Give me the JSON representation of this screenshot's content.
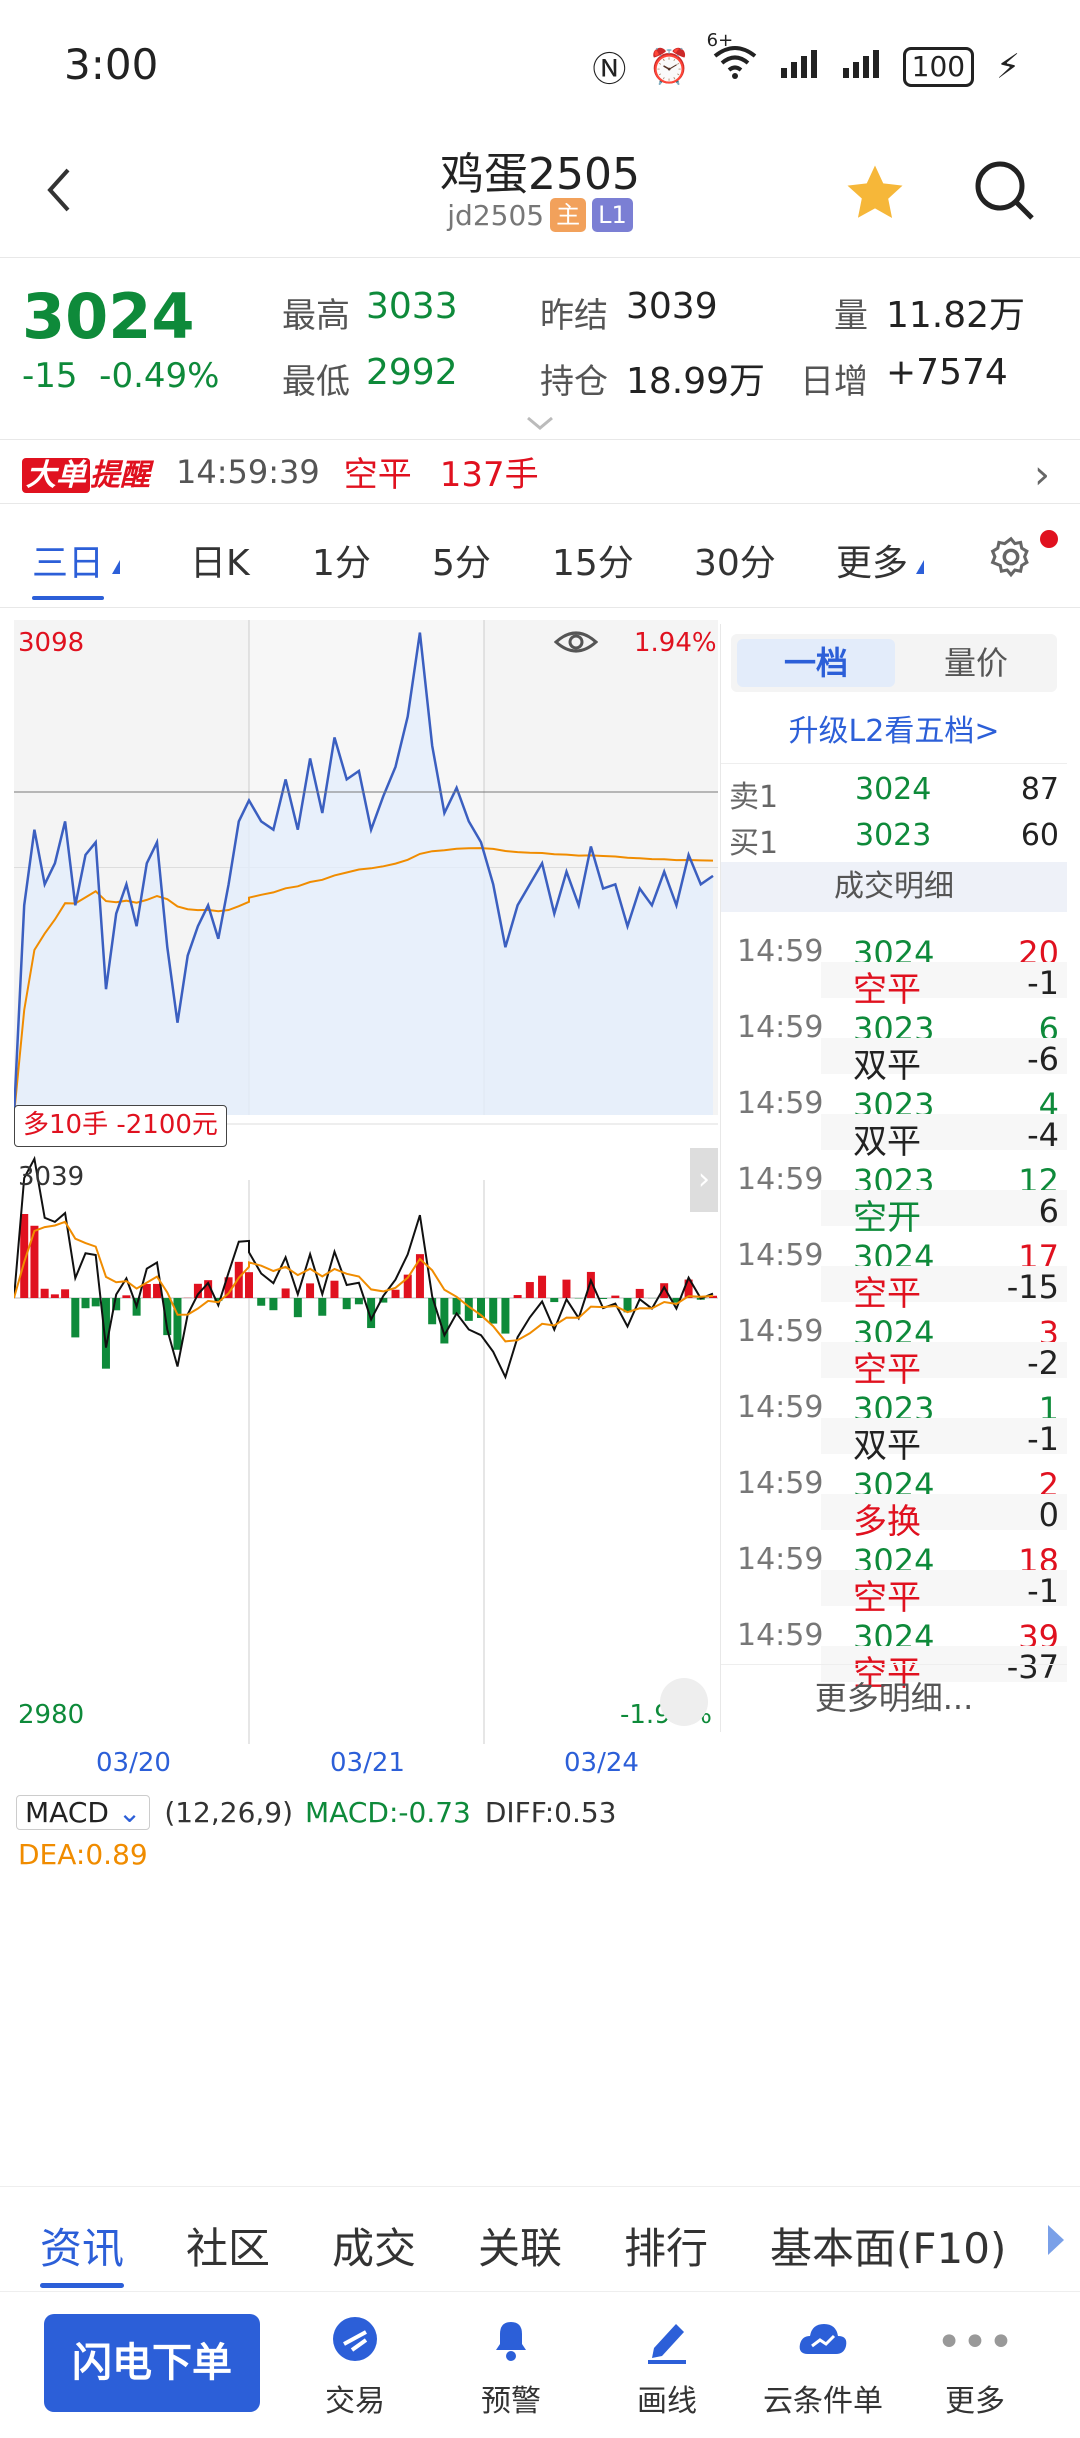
{
  "status_bar": {
    "time": "3:00",
    "signal_label": "6+",
    "battery": "100"
  },
  "header": {
    "title": "鸡蛋2505",
    "code": "jd2505",
    "tag_main": "主",
    "tag_level": "L1"
  },
  "quote": {
    "price": "3024",
    "change": "-15",
    "change_pct": "-0.49%",
    "high_label": "最高",
    "high": "3033",
    "low_label": "最低",
    "low": "2992",
    "prev_settle_label": "昨结",
    "prev_settle": "3039",
    "open_int_label": "持仓",
    "open_int": "18.99万",
    "volume_label": "量",
    "volume": "11.82万",
    "daily_inc_label": "日增",
    "daily_inc": "+7574"
  },
  "alert": {
    "badge_a": "大单",
    "badge_b": "提醒",
    "time": "14:59:39",
    "action": "空平",
    "volume": "137手"
  },
  "period_tabs": [
    "三日",
    "日K",
    "1分",
    "5分",
    "15分",
    "30分",
    "更多"
  ],
  "chart": {
    "y_top": "3098",
    "y_mid": "3039",
    "y_bot": "2980",
    "pct_top": "1.94%",
    "pct_bot": "-1.94%",
    "position_note": "多10手  -2100元",
    "dates": [
      "03/20",
      "03/21",
      "03/24"
    ],
    "macd": {
      "name": "MACD",
      "params": "(12,26,9)",
      "macd": "MACD:-0.73",
      "diff": "DIFF:0.53",
      "dea": "DEA:0.89"
    }
  },
  "chart_data": {
    "type": "line",
    "price_range": [
      2980,
      3098
    ],
    "reference": 3039,
    "days": [
      "03/20",
      "03/21",
      "03/24"
    ],
    "series": [
      {
        "values": [
          2980,
          3030,
          3048,
          3035,
          3040,
          3050,
          3030,
          3042,
          3045,
          3010,
          3028,
          3035,
          3025,
          3040,
          3045,
          3020,
          3002,
          3018,
          3025,
          3030,
          3022,
          3035,
          3050,
          3055
        ]
      },
      {
        "values": [
          3055,
          3050,
          3048,
          3060,
          3048,
          3065,
          3052,
          3070,
          3060,
          3062,
          3048,
          3056,
          3063,
          3075,
          3095,
          3068,
          3052,
          3058,
          3050,
          3045,
          3035,
          3020,
          3030,
          3035,
          3040,
          3028,
          3038,
          3030,
          3044,
          3034,
          3035,
          3025,
          3034,
          3030,
          3038,
          3030,
          3042,
          3035,
          3037
        ]
      }
    ]
  },
  "side": {
    "tab_on": "一档",
    "tab_off": "量价",
    "upgrade": "升级L2看五档>",
    "ask": {
      "label": "卖1",
      "price": "3024",
      "vol": "87"
    },
    "bid": {
      "label": "买1",
      "price": "3023",
      "vol": "60"
    },
    "section": "成交明细",
    "trades": [
      {
        "time": "14:59",
        "price": "3024",
        "vol": "20",
        "vol_color": "red",
        "action": "空平",
        "action_color": "red",
        "delta": "-1"
      },
      {
        "time": "14:59",
        "price": "3023",
        "vol": "6",
        "vol_color": "green",
        "action": "双平",
        "action_color": "black",
        "delta": "-6"
      },
      {
        "time": "14:59",
        "price": "3023",
        "vol": "4",
        "vol_color": "green",
        "action": "双平",
        "action_color": "black",
        "delta": "-4"
      },
      {
        "time": "14:59",
        "price": "3023",
        "vol": "12",
        "vol_color": "green",
        "action": "空开",
        "action_color": "green",
        "delta": "6"
      },
      {
        "time": "14:59",
        "price": "3024",
        "vol": "17",
        "vol_color": "red",
        "action": "空平",
        "action_color": "red",
        "delta": "-15"
      },
      {
        "time": "14:59",
        "price": "3024",
        "vol": "3",
        "vol_color": "red",
        "action": "空平",
        "action_color": "red",
        "delta": "-2"
      },
      {
        "time": "14:59",
        "price": "3023",
        "vol": "1",
        "vol_color": "green",
        "action": "双平",
        "action_color": "black",
        "delta": "-1"
      },
      {
        "time": "14:59",
        "price": "3024",
        "vol": "2",
        "vol_color": "red",
        "action": "多换",
        "action_color": "red",
        "delta": "0"
      },
      {
        "time": "14:59",
        "price": "3024",
        "vol": "18",
        "vol_color": "red",
        "action": "空平",
        "action_color": "red",
        "delta": "-1"
      },
      {
        "time": "14:59",
        "price": "3024",
        "vol": "39",
        "vol_color": "red",
        "action": "空平",
        "action_color": "red",
        "delta": "-37"
      }
    ],
    "more": "更多明细..."
  },
  "news_tabs": [
    "资讯",
    "社区",
    "成交",
    "关联",
    "排行",
    "基本面(F10)"
  ],
  "bottom": {
    "flash": "闪电下单",
    "items": [
      {
        "label": "交易",
        "icon": "trade-icon"
      },
      {
        "label": "预警",
        "icon": "bell-icon"
      },
      {
        "label": "画线",
        "icon": "pen-icon"
      },
      {
        "label": "云条件单",
        "icon": "cloud-order-icon"
      },
      {
        "label": "更多",
        "icon": "more-dots-icon"
      }
    ]
  },
  "colors": {
    "accent": "#2c5fd8",
    "up": "#e0111f",
    "down": "#0e8a3a",
    "avg": "#f08c00"
  }
}
